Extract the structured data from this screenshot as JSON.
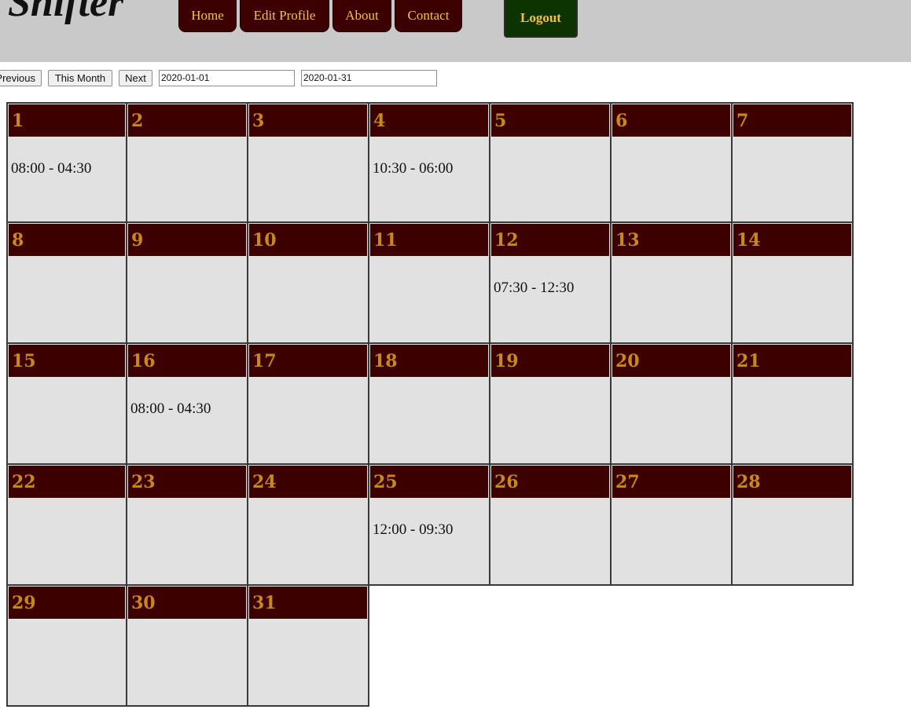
{
  "app": {
    "logo": "Shifter"
  },
  "nav": {
    "home": "Home",
    "edit_profile": "Edit Profile",
    "about": "About",
    "contact": "Contact",
    "logout": "Logout"
  },
  "controls": {
    "previous": "Previous",
    "this_month": "This Month",
    "next": "Next",
    "start_date": "2020-01-01",
    "end_date": "2020-01-31"
  },
  "calendar": {
    "weeks": [
      [
        {
          "day": "1",
          "shift": "08:00 - 04:30"
        },
        {
          "day": "2",
          "shift": ""
        },
        {
          "day": "3",
          "shift": ""
        },
        {
          "day": "4",
          "shift": "10:30 - 06:00"
        },
        {
          "day": "5",
          "shift": ""
        },
        {
          "day": "6",
          "shift": ""
        },
        {
          "day": "7",
          "shift": ""
        }
      ],
      [
        {
          "day": "8",
          "shift": ""
        },
        {
          "day": "9",
          "shift": ""
        },
        {
          "day": "10",
          "shift": ""
        },
        {
          "day": "11",
          "shift": ""
        },
        {
          "day": "12",
          "shift": "07:30 - 12:30"
        },
        {
          "day": "13",
          "shift": ""
        },
        {
          "day": "14",
          "shift": ""
        }
      ],
      [
        {
          "day": "15",
          "shift": ""
        },
        {
          "day": "16",
          "shift": "08:00 - 04:30"
        },
        {
          "day": "17",
          "shift": ""
        },
        {
          "day": "18",
          "shift": ""
        },
        {
          "day": "19",
          "shift": ""
        },
        {
          "day": "20",
          "shift": ""
        },
        {
          "day": "21",
          "shift": ""
        }
      ],
      [
        {
          "day": "22",
          "shift": ""
        },
        {
          "day": "23",
          "shift": ""
        },
        {
          "day": "24",
          "shift": ""
        },
        {
          "day": "25",
          "shift": "12:00 - 09:30"
        },
        {
          "day": "26",
          "shift": ""
        },
        {
          "day": "27",
          "shift": ""
        },
        {
          "day": "28",
          "shift": ""
        }
      ],
      [
        {
          "day": "29",
          "shift": ""
        },
        {
          "day": "30",
          "shift": ""
        },
        {
          "day": "31",
          "shift": ""
        }
      ]
    ]
  },
  "colors": {
    "header_bg": "#c9c9c9",
    "nav_bg": "#3d0000",
    "nav_text": "#f3c04a",
    "logout_bg": "#0c3300",
    "day_header_bg": "#3d0000",
    "day_number": "#c8891c",
    "cell_bg": "#e1e1e1"
  }
}
